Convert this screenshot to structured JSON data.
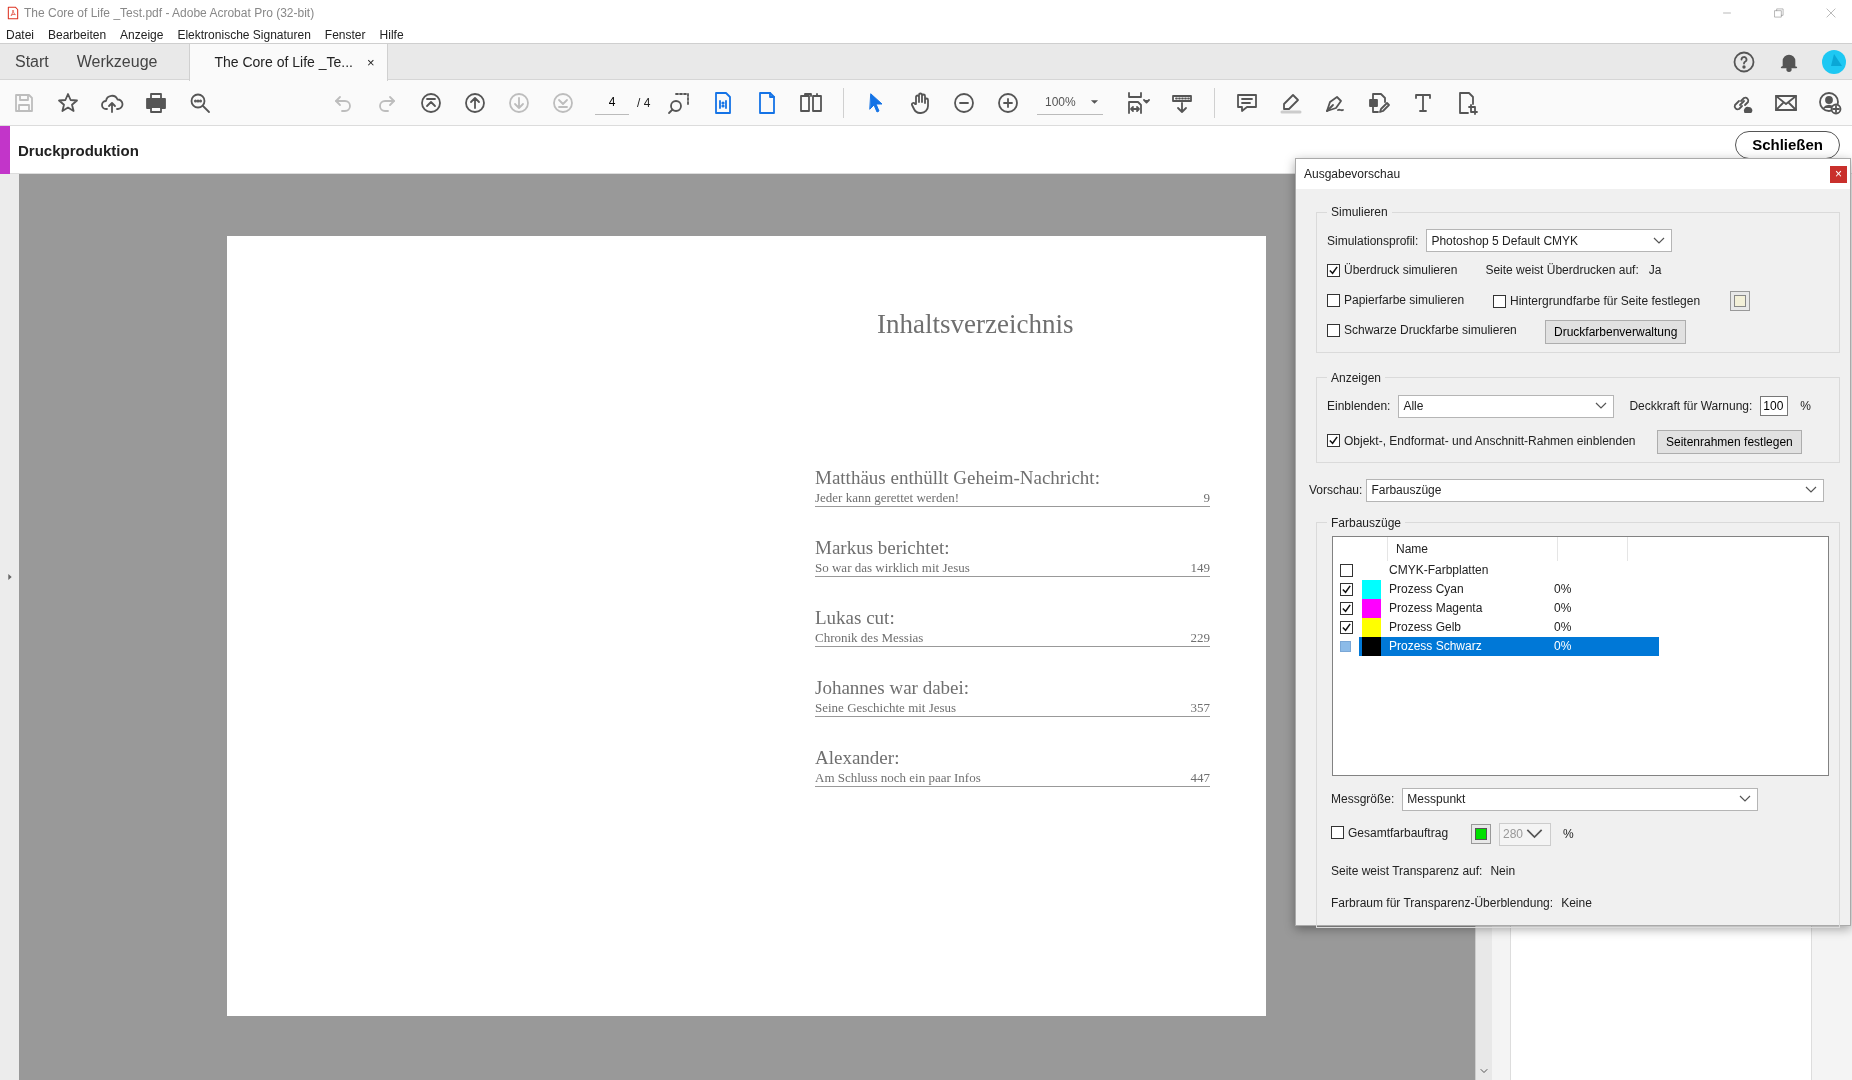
{
  "window": {
    "title": "The Core of Life _Test.pdf - Adobe Acrobat Pro (32-bit)"
  },
  "menu": [
    "Datei",
    "Bearbeiten",
    "Anzeige",
    "Elektronische Signaturen",
    "Fenster",
    "Hilfe"
  ],
  "tabs": [
    {
      "label": "Start",
      "selected": false
    },
    {
      "label": "Werkzeuge",
      "selected": false
    },
    {
      "label": "The Core of Life _Te...",
      "selected": true,
      "close": "×"
    }
  ],
  "toolbar": [
    {
      "kind": "save",
      "disabled": true,
      "selected": false
    },
    {
      "kind": "star",
      "disabled": false,
      "selected": false
    },
    {
      "kind": "cloud-upload",
      "disabled": false,
      "selected": false
    },
    {
      "kind": "print",
      "disabled": false,
      "selected": false
    },
    {
      "kind": "search",
      "disabled": false,
      "selected": false
    },
    {
      "kind": "undo",
      "disabled": true,
      "selected": false
    },
    {
      "kind": "redo",
      "disabled": true,
      "selected": false
    },
    {
      "kind": "first-page",
      "disabled": false,
      "selected": false
    },
    {
      "kind": "previous-page",
      "disabled": false,
      "selected": false
    },
    {
      "kind": "next-page",
      "disabled": true,
      "selected": false
    },
    {
      "kind": "last-page",
      "disabled": true,
      "selected": false
    },
    {
      "kind": "page",
      "value": "4",
      "total": "/ 4"
    },
    {
      "kind": "marquee-zoom",
      "disabled": false,
      "selected": false
    },
    {
      "kind": "actual-size",
      "disabled": false,
      "selected": true
    },
    {
      "kind": "single-page",
      "disabled": false,
      "selected": true
    },
    {
      "kind": "two-page",
      "disabled": false,
      "selected": false
    },
    {
      "kind": "select",
      "disabled": false,
      "selected": true
    },
    {
      "kind": "hand",
      "disabled": false,
      "selected": false
    },
    {
      "kind": "zoom-out",
      "disabled": false,
      "selected": false
    },
    {
      "kind": "zoom-in",
      "disabled": false,
      "selected": false
    },
    {
      "kind": "zoom",
      "value": "100%"
    },
    {
      "kind": "fit-page",
      "disabled": false,
      "selected": false
    },
    {
      "kind": "scroll-mode",
      "disabled": false,
      "selected": false
    },
    {
      "kind": "comment",
      "disabled": false,
      "selected": false
    },
    {
      "kind": "highlight",
      "disabled": false,
      "selected": false
    },
    {
      "kind": "sign",
      "disabled": false,
      "selected": false
    },
    {
      "kind": "edit-pdf",
      "disabled": false,
      "selected": false
    },
    {
      "kind": "text",
      "disabled": false,
      "selected": false
    },
    {
      "kind": "crop",
      "disabled": false,
      "selected": false
    },
    {
      "kind": "share-link",
      "disabled": false,
      "selected": false
    },
    {
      "kind": "mail",
      "disabled": false,
      "selected": false
    },
    {
      "kind": "add-person",
      "disabled": false,
      "selected": false
    }
  ],
  "tool_panel": {
    "title": "Druckproduktion",
    "close_button": "Schließen"
  },
  "document": {
    "heading": "Inhaltsverzeichnis",
    "entries": [
      {
        "title": "Matthäus enthüllt Geheim-Nachricht:",
        "subtitle": "Jeder kann gerettet werden!",
        "page": "9"
      },
      {
        "title": "Markus berichtet:",
        "subtitle": "So war das wirklich mit Jesus",
        "page": "149"
      },
      {
        "title": "Lukas cut:",
        "subtitle": "Chronik des Messias",
        "page": "229"
      },
      {
        "title": "Johannes war dabei:",
        "subtitle": "Seine Geschichte mit Jesus",
        "page": "357"
      },
      {
        "title": "Alexander:",
        "subtitle": "Am Schluss noch ein paar Infos",
        "page": "447"
      }
    ]
  },
  "dialog": {
    "title": "Ausgabevorschau",
    "close": "×",
    "simulate": {
      "legend": "Simulieren",
      "profile_label": "Simulationsprofil:",
      "profile": "Photoshop 5 Default CMYK",
      "overprint": {
        "label": "Überdruck simulieren",
        "checked": true
      },
      "overprint_info_label": "Seite weist Überdrucken auf:",
      "overprint_info": "Ja",
      "paper": {
        "label": "Papierfarbe simulieren",
        "checked": false
      },
      "background": {
        "label": "Hintergrundfarbe für Seite festlegen",
        "checked": false
      },
      "black": {
        "label": "Schwarze Druckfarbe simulieren",
        "checked": false
      },
      "ink_button": "Druckfarbenverwaltung"
    },
    "show": {
      "legend": "Anzeigen",
      "show_label": "Einblenden:",
      "show_value": "Alle",
      "opacity_label": "Deckkraft für Warnung:",
      "opacity": "100",
      "opacity_unit": "%",
      "frames": {
        "label": "Objekt-, Endformat- und Anschnitt-Rahmen einblenden",
        "checked": true
      },
      "frames_button": "Seitenrahmen festlegen"
    },
    "preview_label": "Vorschau:",
    "preview": "Farbauszüge",
    "separations": {
      "legend": "Farbauszüge",
      "column": "Name",
      "plates": [
        {
          "name": "CMYK-Farbplatten",
          "checked": false,
          "selected": false
        },
        {
          "name": "Prozess Cyan",
          "checked": true,
          "selected": false,
          "color": "#00ffff",
          "coverage": "0%"
        },
        {
          "name": "Prozess Magenta",
          "checked": true,
          "selected": false,
          "color": "#ff00ff",
          "coverage": "0%"
        },
        {
          "name": "Prozess Gelb",
          "checked": true,
          "selected": false,
          "color": "#ffff00",
          "coverage": "0%"
        },
        {
          "name": "Prozess Schwarz",
          "checked": false,
          "selected": true,
          "color": "#000000",
          "coverage": "0%"
        }
      ]
    },
    "measure_label": "Messgröße:",
    "measure": "Messpunkt",
    "total_ink": {
      "label": "Gesamtfarbauftrag",
      "checked": false,
      "value": "280",
      "disabled": true,
      "unit": "%"
    },
    "transparency_label": "Seite weist Transparenz auf:",
    "transparency": "Nein",
    "blend_label": "Farbraum für Transparenz-Überblendung:",
    "blend": "Keine"
  }
}
